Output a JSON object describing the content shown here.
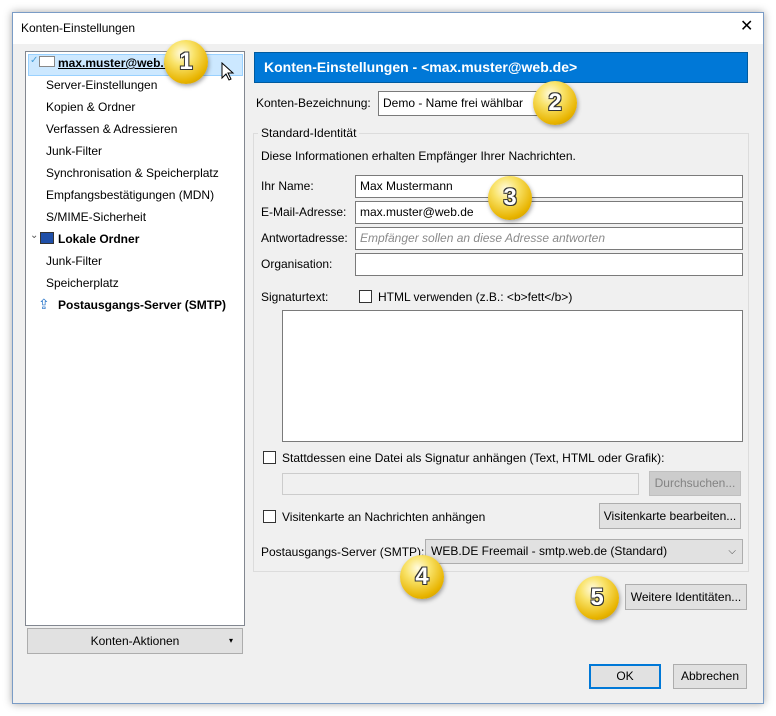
{
  "window": {
    "title": "Konten-Einstellungen",
    "close": "✕"
  },
  "tree": {
    "items": [
      {
        "label": "max.muster@web.de",
        "bold": true,
        "icon": "envelope-icon",
        "selected": true
      },
      {
        "label": "Server-Einstellungen"
      },
      {
        "label": "Kopien & Ordner"
      },
      {
        "label": "Verfassen & Adressieren"
      },
      {
        "label": "Junk-Filter"
      },
      {
        "label": "Synchronisation & Speicherplatz"
      },
      {
        "label": "Empfangsbestätigungen (MDN)"
      },
      {
        "label": "S/MIME-Sicherheit"
      },
      {
        "label": "Lokale Ordner",
        "bold": true,
        "icon": "computer-icon"
      },
      {
        "label": "Junk-Filter"
      },
      {
        "label": "Speicherplatz"
      },
      {
        "label": "Postausgangs-Server (SMTP)",
        "bold": true,
        "icon": "outgoing-server-icon"
      }
    ],
    "account_actions": "Konten-Aktionen"
  },
  "main": {
    "header": "Konten-Einstellungen - <max.muster@web.de>",
    "account_name_label": "Konten-Bezeichnung:",
    "account_name_value": "Demo - Name frei wählbar",
    "identity_group": "Standard-Identität",
    "identity_info": "Diese Informationen erhalten Empfänger Ihrer Nachrichten.",
    "name_label": "Ihr Name:",
    "name_value": "Max Mustermann",
    "email_label": "E-Mail-Adresse:",
    "email_value": "max.muster@web.de",
    "reply_label": "Antwortadresse:",
    "reply_placeholder": "Empfänger sollen an diese Adresse antworten",
    "org_label": "Organisation:",
    "org_value": "",
    "sig_label": "Signaturtext:",
    "html_checkbox": "HTML verwenden (z.B.: <b>fett</b>)",
    "sig_file_checkbox": "Stattdessen eine Datei als Signatur anhängen (Text, HTML oder Grafik):",
    "browse": "Durchsuchen...",
    "vcard_checkbox": "Visitenkarte an Nachrichten anhängen",
    "vcard_edit": "Visitenkarte bearbeiten...",
    "smtp_label": "Postausgangs-Server (SMTP):",
    "smtp_value": "WEB.DE Freemail - smtp.web.de (Standard)",
    "more_identities": "Weitere Identitäten..."
  },
  "footer": {
    "ok": "OK",
    "cancel": "Abbrechen"
  },
  "badges": [
    "1",
    "2",
    "3",
    "4",
    "5"
  ],
  "colors": {
    "header": "#0078d7",
    "selection": "#cce8ff",
    "badge": "#e8b400"
  }
}
